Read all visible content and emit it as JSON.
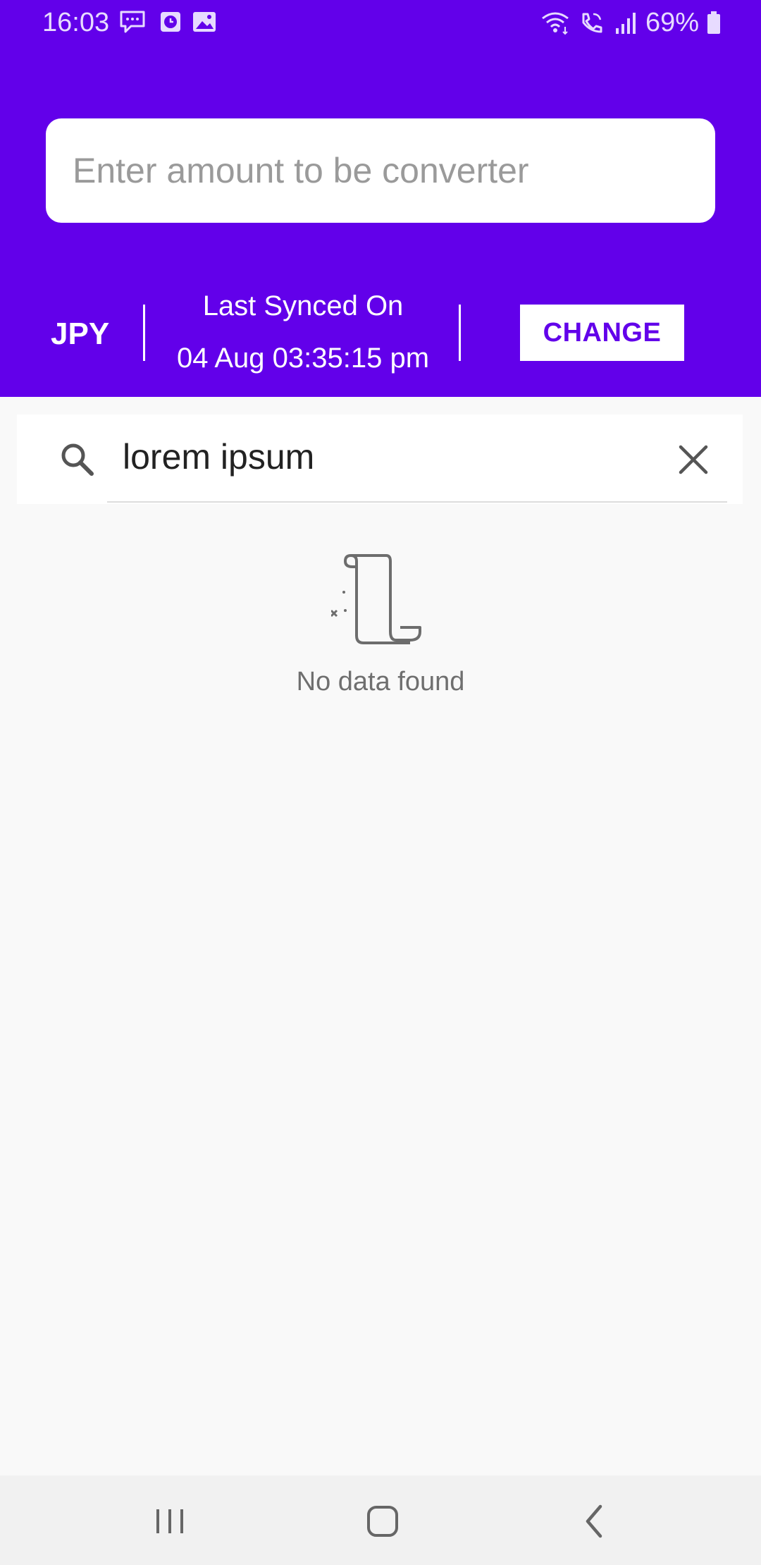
{
  "status_bar": {
    "time": "16:03",
    "battery": "69%",
    "left_icons": [
      "message-icon",
      "clock-notification-icon",
      "image-icon"
    ],
    "right_icons": [
      "wifi-icon",
      "wifi-calling-icon",
      "signal-icon",
      "battery-icon"
    ]
  },
  "converter": {
    "amount_placeholder": "Enter amount to be converter",
    "currency": "JPY",
    "sync_label": "Last Synced On",
    "sync_time": "04 Aug 03:35:15 pm",
    "change_label": "CHANGE"
  },
  "search": {
    "query": "lorem ipsum",
    "icon": "search-icon",
    "clear_icon": "close-icon"
  },
  "empty_state": {
    "icon": "scroll-icon",
    "message": "No data found"
  },
  "nav": {
    "recent_icon": "recent-apps-icon",
    "home_icon": "home-icon",
    "back_icon": "back-icon"
  },
  "colors": {
    "primary": "#6200ea",
    "background": "#f9f9f9",
    "nav_background": "#f1f1f1"
  }
}
